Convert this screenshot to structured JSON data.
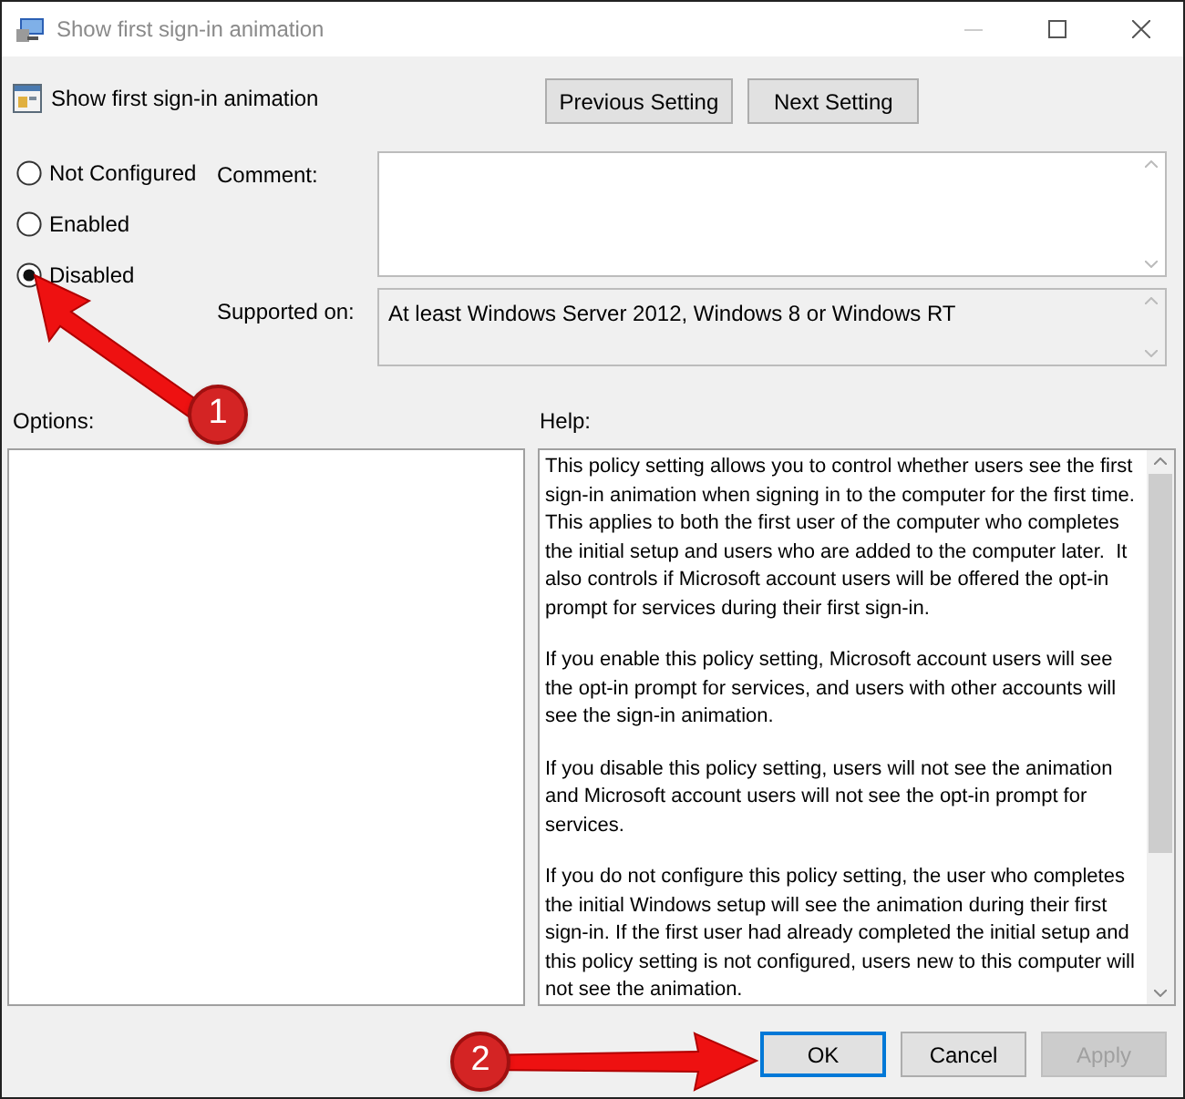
{
  "window": {
    "title": "Show first sign-in animation"
  },
  "setting_title": "Show first sign-in animation",
  "nav_buttons": [
    "Previous Setting",
    "Next Setting"
  ],
  "state_options": [
    {
      "label": "Not Configured",
      "selected": false
    },
    {
      "label": "Enabled",
      "selected": false
    },
    {
      "label": "Disabled",
      "selected": true
    }
  ],
  "comment": {
    "label": "Comment:"
  },
  "supported_on": {
    "label": "Supported on:",
    "value": "At least Windows Server 2012, Windows 8 or Windows RT"
  },
  "options_label": "Options:",
  "help_label": "Help:",
  "help_text": [
    "This policy setting allows you to control whether users see the first sign-in animation when signing in to the computer for the first time.  This applies to both the first user of the computer who completes the initial setup and users who are added to the computer later.  It also controls if Microsoft account users will be offered the opt-in prompt for services during their first sign-in.",
    "If you enable this policy setting, Microsoft account users will see the opt-in prompt for services, and users with other accounts will see the sign-in animation.",
    "If you disable this policy setting, users will not see the animation and Microsoft account users will not see the opt-in prompt for services.",
    "If you do not configure this policy setting, the user who completes the initial Windows setup will see the animation during their first sign-in. If the first user had already completed the initial setup and this policy setting is not configured, users new to this computer will not see the animation."
  ],
  "buttons": [
    {
      "label": "OK",
      "focused": true,
      "disabled": false
    },
    {
      "label": "Cancel",
      "focused": false,
      "disabled": false
    },
    {
      "label": "Apply",
      "focused": false,
      "disabled": true
    }
  ],
  "callouts": [
    {
      "number": "1"
    },
    {
      "number": "2"
    }
  ]
}
